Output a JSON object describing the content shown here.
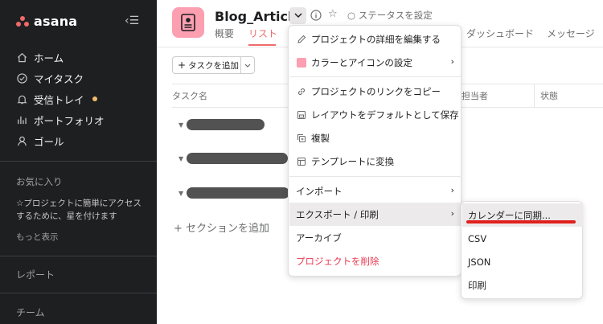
{
  "colors": {
    "accent": "#f06a6a",
    "sidebar_bg": "#1e1f21",
    "project_icon": "#fb9fb1",
    "danger": "#e8384f",
    "annotation": "#e0201d"
  },
  "sidebar": {
    "logo": "asana",
    "nav": [
      {
        "label": "ホーム",
        "icon": "home-icon"
      },
      {
        "label": "マイタスク",
        "icon": "check-circle-icon"
      },
      {
        "label": "受信トレイ",
        "icon": "bell-icon"
      },
      {
        "label": "ポートフォリオ",
        "icon": "bar-chart-icon"
      },
      {
        "label": "ゴール",
        "icon": "person-icon"
      }
    ],
    "favorites_title": "お気に入り",
    "favorites_hint": "☆プロジェクトに簡単にアクセスするために、星を付けます",
    "show_more": "もっと表示",
    "reports": "レポート",
    "teams": "チーム"
  },
  "header": {
    "project_title": "Blog_Article",
    "set_status": "○ ステータスを設定",
    "tabs": {
      "overview": "概要",
      "list": "リスト",
      "dashboard": "ダッシュボード",
      "messages": "メッセージ"
    }
  },
  "toolbar": {
    "add_task": "タスクを追加"
  },
  "table": {
    "columns": {
      "task_name": "タスク名",
      "assignee": "担当者",
      "status": "状態"
    },
    "add_section": "セクションを追加"
  },
  "menu": {
    "items": [
      {
        "label": "プロジェクトの詳細を編集する",
        "icon": "pencil-icon"
      },
      {
        "label": "カラーとアイコンの設定",
        "icon": "color-swatch-icon"
      },
      {
        "label": "プロジェクトのリンクをコピー",
        "icon": "link-icon"
      },
      {
        "label": "レイアウトをデフォルトとして保存",
        "icon": "save-icon"
      },
      {
        "label": "複製",
        "icon": "duplicate-icon"
      },
      {
        "label": "テンプレートに変換",
        "icon": "template-icon"
      },
      {
        "label": "インポート"
      },
      {
        "label": "エクスポート / 印刷"
      },
      {
        "label": "アーカイブ"
      },
      {
        "label": "プロジェクトを削除"
      }
    ]
  },
  "submenu": {
    "items": [
      {
        "label": "カレンダーに同期..."
      },
      {
        "label": "CSV"
      },
      {
        "label": "JSON"
      },
      {
        "label": "印刷"
      }
    ]
  }
}
